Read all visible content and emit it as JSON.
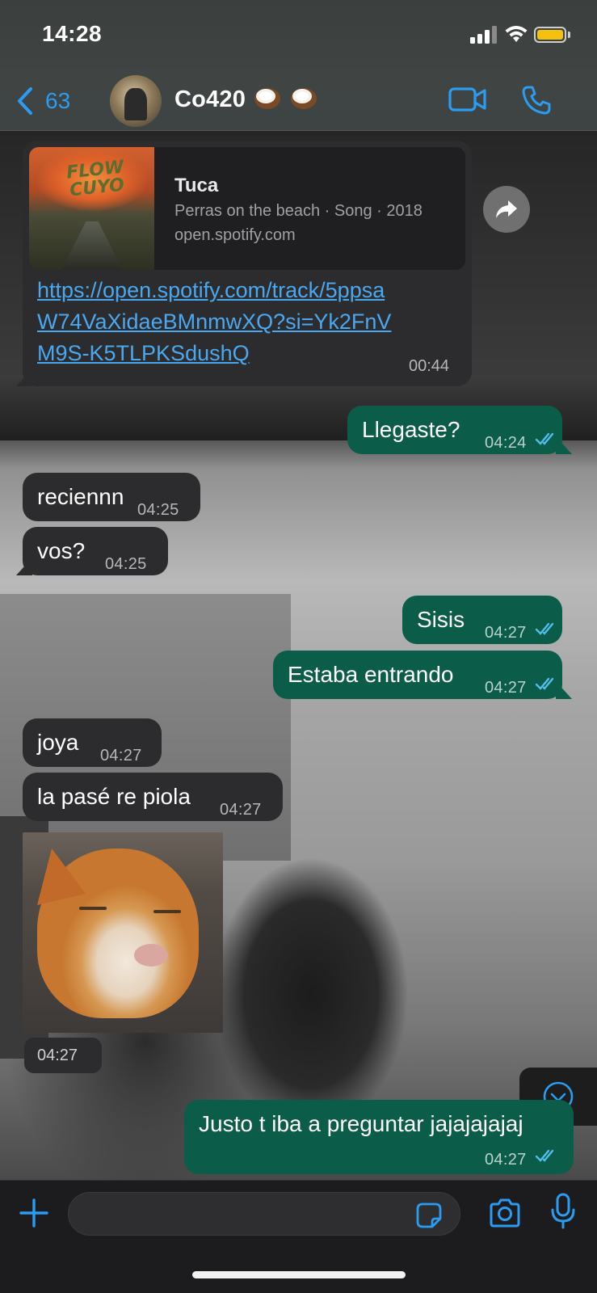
{
  "status_bar": {
    "time": "14:28"
  },
  "header": {
    "back_count": "63",
    "contact_name": "Co420"
  },
  "messages": {
    "link_card": {
      "song_title": "Tuca",
      "song_meta": "Perras on the beach · Song · 2018",
      "site": "open.spotify.com",
      "album_art_text": "FLOW CUYO",
      "url": "https://open.spotify.com/track/5ppsaW74VaXidaeBMnmwXQ?si=Yk2FnVM9S-K5TLPKSdushQ",
      "time": "00:44"
    },
    "m1": {
      "text": "Llegaste?",
      "time": "04:24"
    },
    "m2": {
      "text": "reciennn",
      "time": "04:25"
    },
    "m3": {
      "text": "vos?",
      "time": "04:25"
    },
    "m4": {
      "text": "Sisis",
      "time": "04:27"
    },
    "m5": {
      "text": "Estaba entrando",
      "time": "04:27"
    },
    "m6": {
      "text": "joya",
      "time": "04:27"
    },
    "m7": {
      "text": "la pasé re piola",
      "time": "04:27"
    },
    "image_msg": {
      "time": "04:27"
    },
    "m8": {
      "text": "Justo t iba a preguntar jajajajajaj",
      "time": "04:27"
    }
  },
  "input_bar": {
    "placeholder": ""
  },
  "colors": {
    "accent": "#2b9cf2",
    "outgoing_bubble": "#0c5c4a",
    "incoming_bubble": "#2c2c2e",
    "read_ticks": "#53bdeb"
  },
  "icons": [
    "back-chevron",
    "video-camera",
    "phone",
    "forward-arrow",
    "scroll-down-chevron",
    "plus",
    "sticker",
    "camera",
    "microphone",
    "coconut-emoji"
  ]
}
